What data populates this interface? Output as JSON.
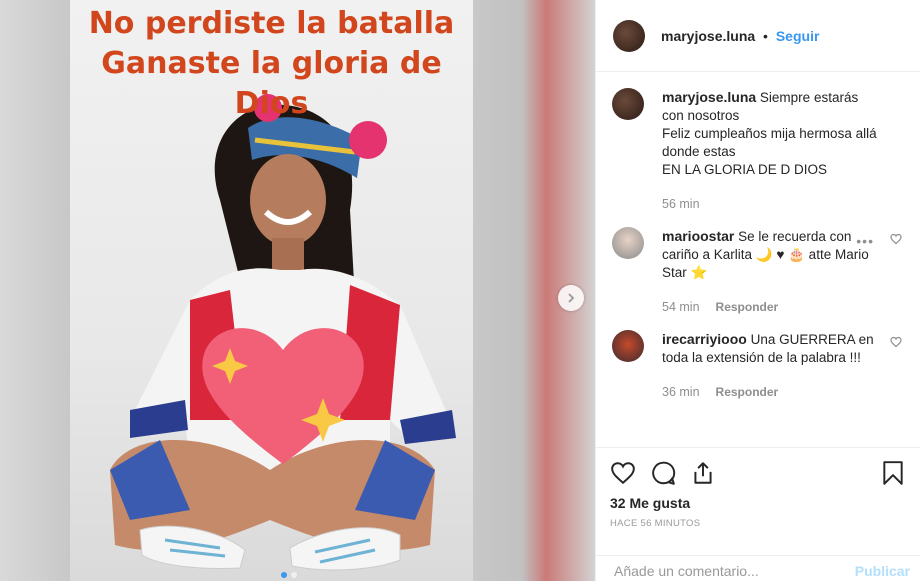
{
  "media": {
    "caption_line1": "No perdiste la batalla",
    "caption_line2": "Ganaste la gloria de Dios"
  },
  "header": {
    "username": "maryjose.luna",
    "separator": "•",
    "follow_label": "Seguir"
  },
  "comments": [
    {
      "username": "maryjose.luna",
      "text": "Siempre estarás con nosotros\nFeliz cumpleaños mija hermosa allá donde estas\nEN LA GLORIA DE D DIOS",
      "time": "56 min"
    },
    {
      "username": "marioostar",
      "text": "Se le recuerda con cariño a Karlita 🌙 ♥ 🎂 atte Mario Star ⭐",
      "time": "54 min",
      "reply_label": "Responder",
      "more": "•••"
    },
    {
      "username": "irecarriyiooo",
      "text": "Una GUERRERA en toda la extensión de la palabra !!!",
      "time": "36 min",
      "reply_label": "Responder"
    }
  ],
  "actions": {
    "likes": "32 Me gusta",
    "timestamp": "HACE 56 MINUTOS"
  },
  "composer": {
    "placeholder": "Añade un comentario...",
    "publish_label": "Publicar"
  },
  "colors": {
    "accent": "#3897f0",
    "caption": "#d2461d"
  },
  "icons": [
    "heart-icon",
    "comment-icon",
    "share-icon",
    "bookmark-icon",
    "chevron-right-icon",
    "more-icon"
  ]
}
